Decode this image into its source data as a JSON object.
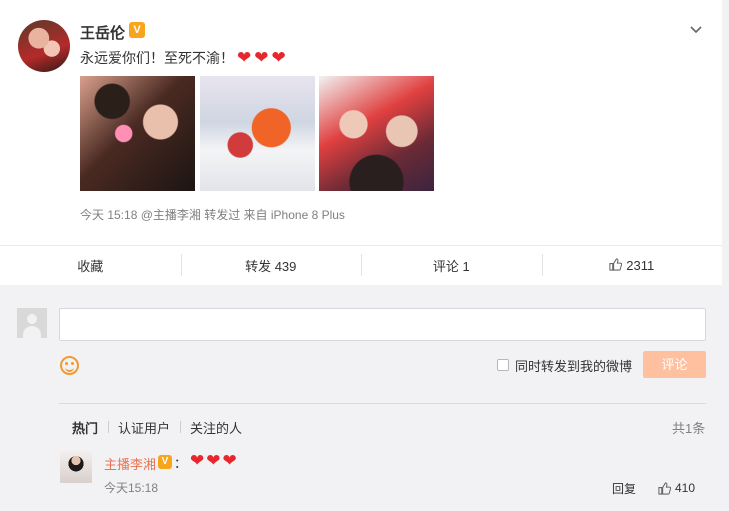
{
  "post": {
    "username": "王岳伦",
    "verified_badge": "V",
    "text": "永远爱你们！至死不渝！",
    "emojis": [
      "heart",
      "heart",
      "heart"
    ],
    "images": [
      "photo-1",
      "photo-2",
      "photo-3"
    ],
    "meta": "今天 15:18 @主播李湘 转发过  来自 iPhone 8 Plus",
    "menu_icon": "chevron-down-icon"
  },
  "actions": {
    "favorite": "收藏",
    "repost": "转发 439",
    "comment": "评论 1",
    "like": "2311"
  },
  "comment_box": {
    "placeholder": "",
    "repost_label": "同时转发到我的微博",
    "submit_label": "评论"
  },
  "filters": {
    "hot": "热门",
    "verified": "认证用户",
    "following": "关注的人",
    "total": "共1条"
  },
  "comments": [
    {
      "author": "主播李湘",
      "verified_badge": "V",
      "colon": "：",
      "time": "今天15:18",
      "reply_label": "回复",
      "likes": "410"
    }
  ],
  "colors": {
    "heart": "#e8262d",
    "submit_bg": "#ffc09f",
    "link": "#eb7350",
    "badge": "#f7a51c"
  }
}
